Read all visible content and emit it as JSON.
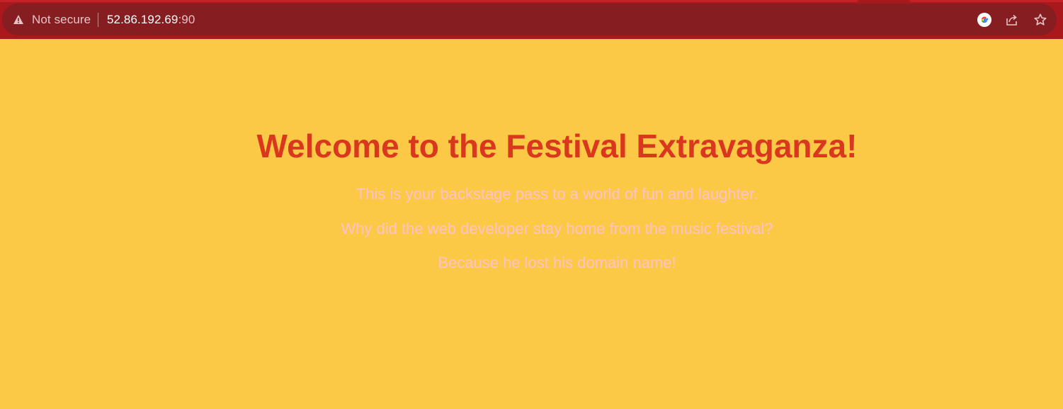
{
  "browser": {
    "security_label": "Not secure",
    "url_host": "52.86.192.69",
    "url_port": ":90",
    "icons": [
      "warning-icon",
      "google-lens-icon",
      "share-icon",
      "bookmark-star-icon"
    ]
  },
  "page": {
    "heading": "Welcome to the Festival Extravaganza!",
    "paragraphs": [
      "This is your backstage pass to a world of fun and laughter.",
      "Why did the web developer stay home from the music festival?",
      "Because he lost his domain name!"
    ]
  },
  "colors": {
    "page_background": "#fcc946",
    "heading_color": "#d9381e",
    "text_color": "#ffc2cd",
    "browser_frame": "#a8181d",
    "omnibox": "#861d20"
  }
}
